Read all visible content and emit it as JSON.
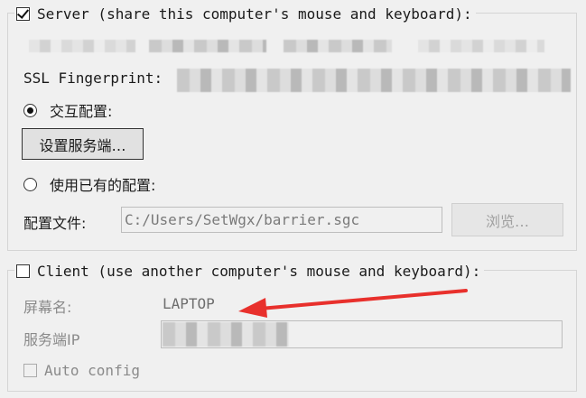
{
  "server": {
    "legend": "Server (share this computer's mouse and keyboard):",
    "checked": true,
    "ssl_label": "SSL Fingerprint:",
    "interactive_label": "交互配置:",
    "configure_button": "设置服务端…",
    "existing_label": "使用已有的配置:",
    "config_file_label": "配置文件:",
    "config_file_value": "C:/Users/SetWgx/barrier.sgc",
    "browse_button": "浏览…"
  },
  "client": {
    "legend": "Client (use another computer's mouse and keyboard):",
    "checked": false,
    "screen_name_label": "屏幕名:",
    "screen_name_value": "LAPTOP",
    "server_ip_label": "服务端IP",
    "auto_config_label": "Auto config"
  },
  "colors": {
    "annotation_arrow": "#e8302c"
  }
}
